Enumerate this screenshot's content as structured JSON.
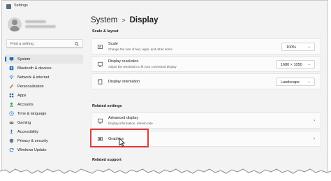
{
  "window": {
    "title": "Settings"
  },
  "sidebar": {
    "search_placeholder": "Find a setting",
    "items": [
      {
        "label": "System",
        "icon": "system-icon",
        "color": "#0f6cbd",
        "selected": true
      },
      {
        "label": "Bluetooth & devices",
        "icon": "bluetooth-icon",
        "color": "#0f6cbd"
      },
      {
        "label": "Network & internet",
        "icon": "wifi-icon",
        "color": "#2b88d8"
      },
      {
        "label": "Personalization",
        "icon": "paintbrush-icon",
        "color": "#c96a1e"
      },
      {
        "label": "Apps",
        "icon": "apps-icon",
        "color": "#4a6ea9"
      },
      {
        "label": "Accounts",
        "icon": "accounts-icon",
        "color": "#2aa360"
      },
      {
        "label": "Time & language",
        "icon": "globe-clock-icon",
        "color": "#2b88d8"
      },
      {
        "label": "Gaming",
        "icon": "gamepad-icon",
        "color": "#6d6d6d"
      },
      {
        "label": "Accessibility",
        "icon": "accessibility-icon",
        "color": "#1d6fb8"
      },
      {
        "label": "Privacy & security",
        "icon": "shield-icon",
        "color": "#6d7a88"
      },
      {
        "label": "Windows Update",
        "icon": "update-icon",
        "color": "#0f6cbd"
      }
    ]
  },
  "breadcrumb": {
    "parent": "System",
    "separator": ">",
    "current": "Display"
  },
  "sections": {
    "scale_layout": "Scale & layout",
    "related_settings": "Related settings",
    "related_support": "Related support"
  },
  "scale": {
    "title": "Scale",
    "description": "Change the size of text, apps, and other items",
    "value": "100%"
  },
  "resolution": {
    "title": "Display resolution",
    "description": "Adjust the resolution to fit your connected display",
    "value": "1680 × 1050"
  },
  "orientation": {
    "title": "Display orientation",
    "value": "Landscape"
  },
  "advanced": {
    "title": "Advanced display",
    "description": "Display information, refresh rate"
  },
  "graphics": {
    "title": "Graphics"
  },
  "colors": {
    "accent": "#0067c0",
    "highlight": "#e03a3a"
  }
}
